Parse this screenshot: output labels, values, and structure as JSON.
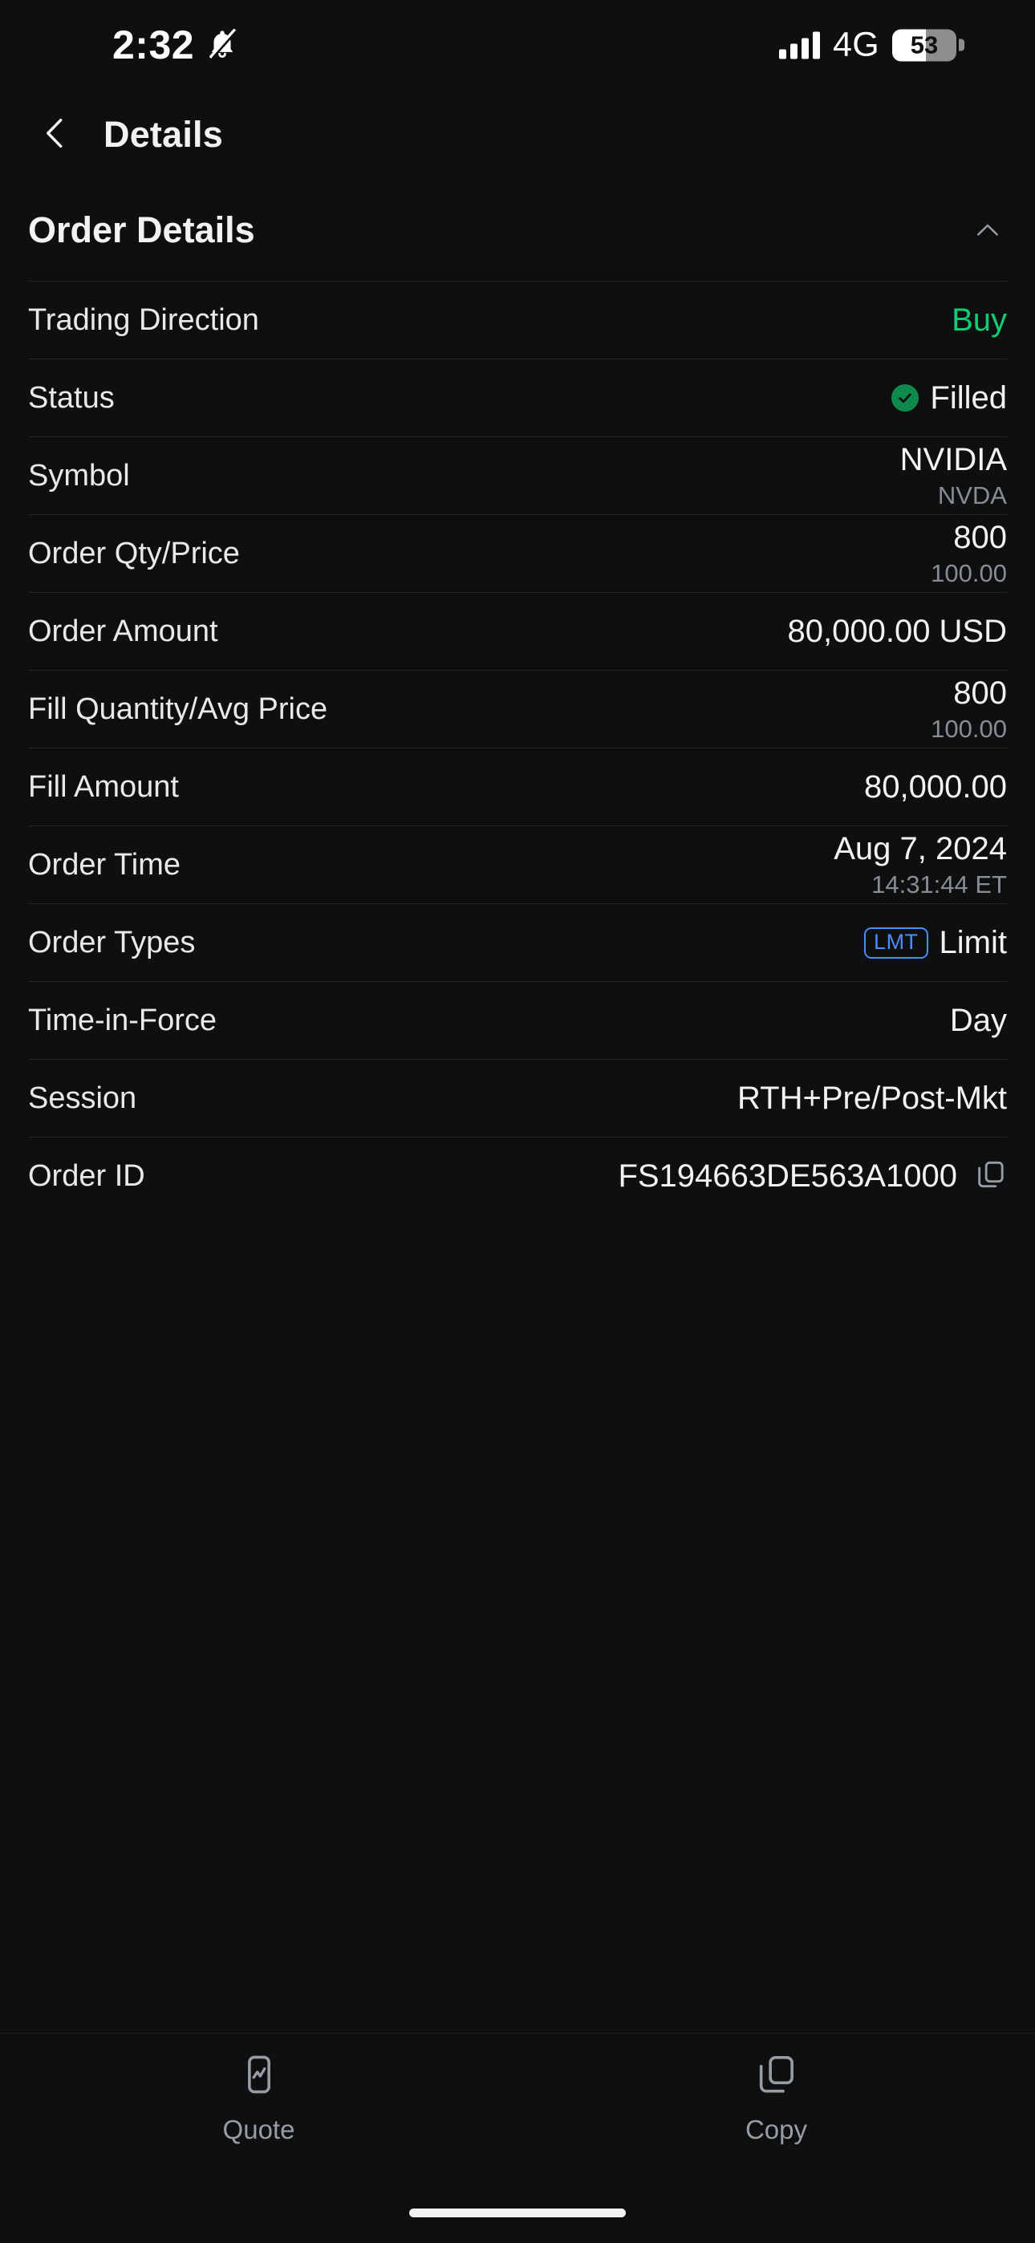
{
  "status_bar": {
    "time": "2:32",
    "silent_icon": "bell-slash-icon",
    "network": "4G",
    "battery_percent": "53",
    "battery_level": 53
  },
  "nav": {
    "back_icon": "chevron-left-icon",
    "title": "Details"
  },
  "section": {
    "title": "Order Details",
    "collapse_icon": "chevron-up-icon"
  },
  "colors": {
    "buy_green": "#13cb72",
    "status_green": "#0f8a4d",
    "badge_blue": "#4b8df8",
    "background": "#0d0f10",
    "divider": "#232527",
    "secondary_text": "#8a8d90"
  },
  "rows": [
    {
      "label": "Trading Direction",
      "value": "Buy",
      "sub": ""
    },
    {
      "label": "Status",
      "value": "Filled",
      "sub": ""
    },
    {
      "label": "Symbol",
      "value": "NVIDIA",
      "sub": "NVDA"
    },
    {
      "label": "Order Qty/Price",
      "value": "800",
      "sub": "100.00"
    },
    {
      "label": "Order Amount",
      "value": "80,000.00 USD",
      "sub": ""
    },
    {
      "label": "Fill Quantity/Avg Price",
      "value": "800",
      "sub": "100.00"
    },
    {
      "label": "Fill Amount",
      "value": "80,000.00",
      "sub": ""
    },
    {
      "label": "Order Time",
      "value": "Aug 7, 2024",
      "sub": "14:31:44 ET"
    },
    {
      "label": "Order Types",
      "value": "Limit",
      "badge": "LMT",
      "sub": ""
    },
    {
      "label": "Time-in-Force",
      "value": "Day",
      "sub": ""
    },
    {
      "label": "Session",
      "value": "RTH+Pre/Post-Mkt",
      "sub": ""
    },
    {
      "label": "Order ID",
      "value": "FS194663DE563A1000",
      "sub": "",
      "copy_icon": "copy-icon"
    }
  ],
  "tab_bar": {
    "items": [
      {
        "label": "Quote",
        "icon": "quote-chart-icon"
      },
      {
        "label": "Copy",
        "icon": "copy-icon"
      }
    ]
  }
}
